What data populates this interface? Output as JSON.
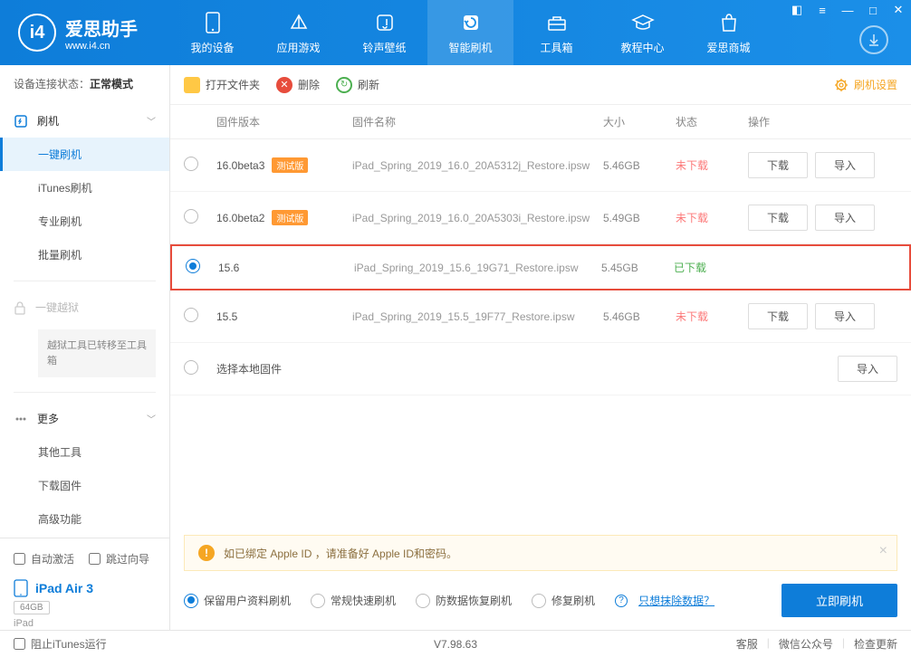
{
  "brand": {
    "title": "爱思助手",
    "sub": "www.i4.cn",
    "logo_char": "i4"
  },
  "nav": [
    {
      "label": "我的设备"
    },
    {
      "label": "应用游戏"
    },
    {
      "label": "铃声壁纸"
    },
    {
      "label": "智能刷机"
    },
    {
      "label": "工具箱"
    },
    {
      "label": "教程中心"
    },
    {
      "label": "爱思商城"
    }
  ],
  "sidebar": {
    "status_label": "设备连接状态：",
    "status_value": "正常模式",
    "flash_header": "刷机",
    "items": [
      "一键刷机",
      "iTunes刷机",
      "专业刷机",
      "批量刷机"
    ],
    "jailbreak": "一键越狱",
    "jailbreak_note": "越狱工具已转移至工具箱",
    "more_header": "更多",
    "more_items": [
      "其他工具",
      "下载固件",
      "高级功能"
    ],
    "auto_activate": "自动激活",
    "skip_guide": "跳过向导",
    "device_name": "iPad Air 3",
    "device_storage": "64GB",
    "device_type": "iPad"
  },
  "toolbar": {
    "open": "打开文件夹",
    "delete": "删除",
    "refresh": "刷新",
    "settings": "刷机设置"
  },
  "table": {
    "headers": {
      "version": "固件版本",
      "name": "固件名称",
      "size": "大小",
      "status": "状态",
      "action": "操作"
    },
    "rows": [
      {
        "version": "16.0beta3",
        "beta": "测试版",
        "name": "iPad_Spring_2019_16.0_20A5312j_Restore.ipsw",
        "size": "5.46GB",
        "status": "未下载",
        "downloaded": false,
        "selected": false,
        "highlight": false
      },
      {
        "version": "16.0beta2",
        "beta": "测试版",
        "name": "iPad_Spring_2019_16.0_20A5303i_Restore.ipsw",
        "size": "5.49GB",
        "status": "未下载",
        "downloaded": false,
        "selected": false,
        "highlight": false
      },
      {
        "version": "15.6",
        "beta": "",
        "name": "iPad_Spring_2019_15.6_19G71_Restore.ipsw",
        "size": "5.45GB",
        "status": "已下载",
        "downloaded": true,
        "selected": true,
        "highlight": true
      },
      {
        "version": "15.5",
        "beta": "",
        "name": "iPad_Spring_2019_15.5_19F77_Restore.ipsw",
        "size": "5.46GB",
        "status": "未下载",
        "downloaded": false,
        "selected": false,
        "highlight": false
      }
    ],
    "local_label": "选择本地固件",
    "btn_download": "下载",
    "btn_import": "导入"
  },
  "banner": {
    "text": "如已绑定 Apple ID ，请准备好 Apple ID和密码。"
  },
  "options": {
    "keep": "保留用户资料刷机",
    "normal": "常规快速刷机",
    "anti": "防数据恢复刷机",
    "repair": "修复刷机",
    "erase_link": "只想抹除数据？",
    "flash_btn": "立即刷机"
  },
  "footer": {
    "block_itunes": "阻止iTunes运行",
    "version": "V7.98.63",
    "links": [
      "客服",
      "微信公众号",
      "检查更新"
    ]
  }
}
